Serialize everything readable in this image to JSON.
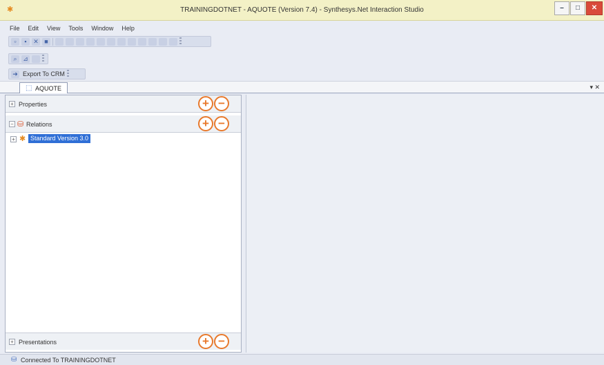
{
  "window": {
    "title": "TRAININGDOTNET - AQUOTE (Version 7.4) - Synthesys.Net Interaction Studio",
    "app_icon": "gear-icon",
    "minimize": "–",
    "maximize": "□",
    "close": "✕"
  },
  "menu": {
    "items": [
      "File",
      "Edit",
      "View",
      "Tools",
      "Window",
      "Help"
    ]
  },
  "toolbar": {
    "export_label": "Export To CRM"
  },
  "tabs": {
    "active": "AQUOTE",
    "close_glyph": "▾ ✕"
  },
  "left_panel": {
    "properties_label": "Properties",
    "relations_label": "Relations",
    "presentations_label": "Presentations",
    "add_glyph": "+",
    "remove_glyph": "−",
    "expand_glyph": "+",
    "collapse_glyph": "−",
    "tree": [
      {
        "label": "Standard Version 3.0"
      }
    ]
  },
  "status": {
    "text": "Connected To TRAININGDOTNET"
  },
  "colors": {
    "titlebar": "#f3f1c6",
    "accent_orange": "#e8792c",
    "selection_blue": "#2f6fd6",
    "close_red": "#d94a3a"
  }
}
